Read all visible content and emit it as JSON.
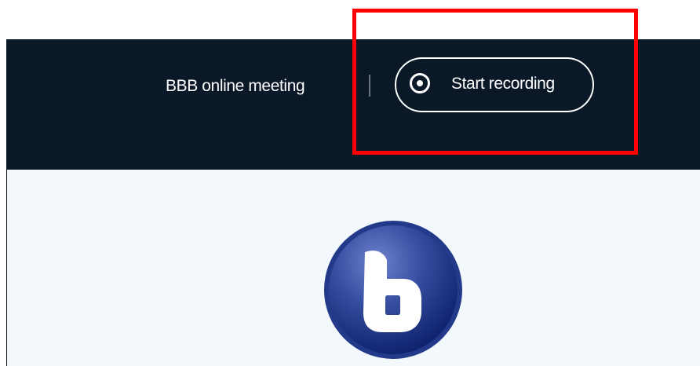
{
  "header": {
    "meeting_title": "BBB online meeting",
    "record_button": {
      "label": "Start recording",
      "icon": "record-icon"
    }
  },
  "main": {
    "logo_icon": "bigbluebutton-logo"
  },
  "colors": {
    "topbar_background": "#0b1828",
    "content_background": "#f2f8fc",
    "text_on_dark": "#ffffff",
    "highlight": "#ff0000"
  }
}
